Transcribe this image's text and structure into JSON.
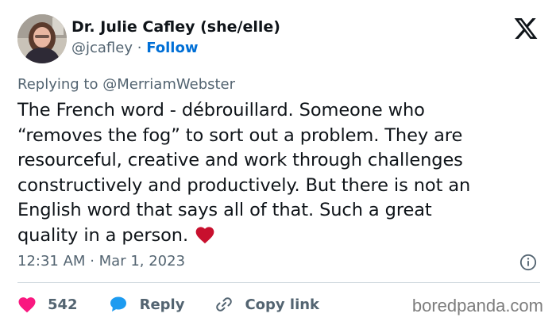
{
  "author": {
    "display_name": "Dr. Julie Cafley (she/elle)",
    "handle": "@jcafley",
    "separator": "·",
    "follow_label": "Follow"
  },
  "reply_context": {
    "prefix": "Replying to",
    "target": "@MerriamWebster"
  },
  "tweet": {
    "lines": [
      "The French word - débrouillard. Someone who",
      "“removes the fog” to sort out a problem. They are",
      "resourceful, creative and work through challenges",
      "constructively and productively. But there is not an",
      "English word that says all of that. Such a great",
      "quality in a person."
    ],
    "emoji": "red-heart-emoji"
  },
  "meta": {
    "time": "12:31 AM",
    "separator": "·",
    "date": "Mar 1, 2023"
  },
  "actions": {
    "like_count": "542",
    "reply_label": "Reply",
    "copy_link_label": "Copy link"
  },
  "watermark": "boredpanda.com",
  "colors": {
    "accent": "#006fd6",
    "like": "#f91880",
    "reply": "#1d9bf0",
    "muted": "#536471",
    "heart_emoji": "#c8102e"
  },
  "icons": [
    "x-logo-icon",
    "info-icon",
    "heart-icon",
    "reply-bubble-icon",
    "link-icon"
  ]
}
